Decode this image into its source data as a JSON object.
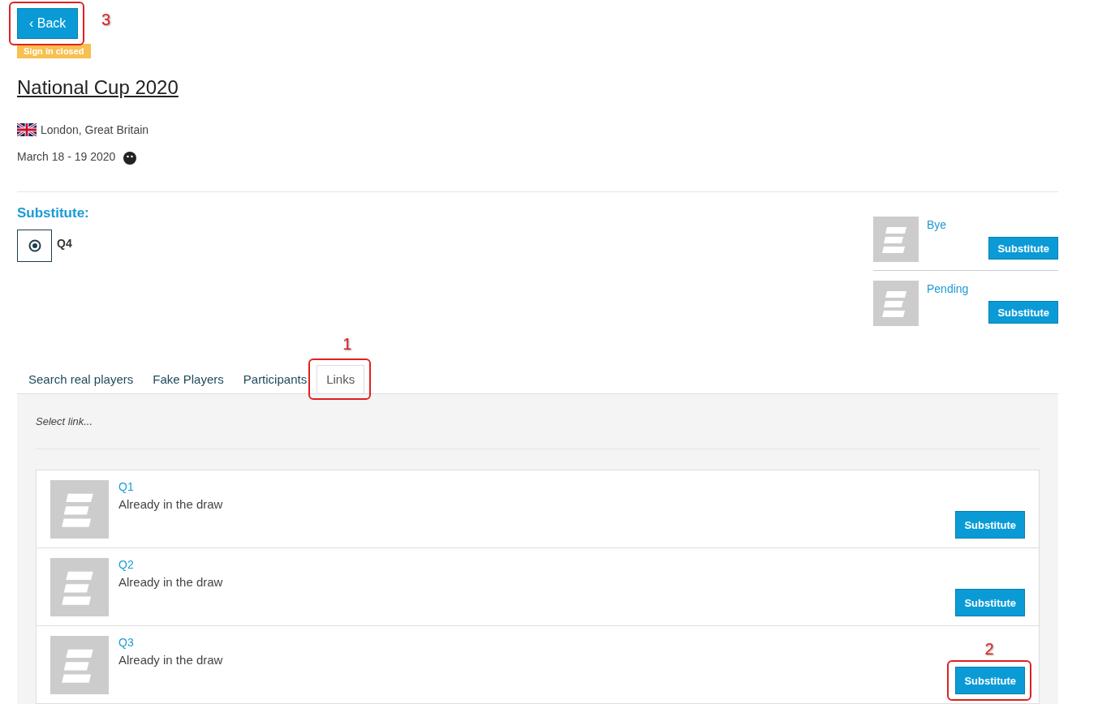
{
  "back_button": {
    "label": "Back",
    "icon": "‹",
    "annotation": "3"
  },
  "status_badge": "Sign in closed",
  "event": {
    "title": "National Cup 2020",
    "location": "London, Great Britain",
    "dates": "March 18 - 19 2020"
  },
  "substitute": {
    "heading": "Substitute:",
    "current": {
      "name": "Q4",
      "selected": true
    }
  },
  "candidates": [
    {
      "name": "Bye",
      "button": "Substitute"
    },
    {
      "name": "Pending",
      "button": "Substitute"
    }
  ],
  "tabs": [
    {
      "label": "Search real players",
      "selected": false
    },
    {
      "label": "Fake Players",
      "selected": false
    },
    {
      "label": "Participants",
      "selected": false
    },
    {
      "label": "Links",
      "selected": true,
      "annotation": "1"
    }
  ],
  "links_panel": {
    "placeholder": "Select link...",
    "items": [
      {
        "name": "Q1",
        "status": "Already in the draw",
        "button": "Substitute"
      },
      {
        "name": "Q2",
        "status": "Already in the draw",
        "button": "Substitute"
      },
      {
        "name": "Q3",
        "status": "Already in the draw",
        "button": "Substitute",
        "annotation": "2"
      }
    ]
  }
}
